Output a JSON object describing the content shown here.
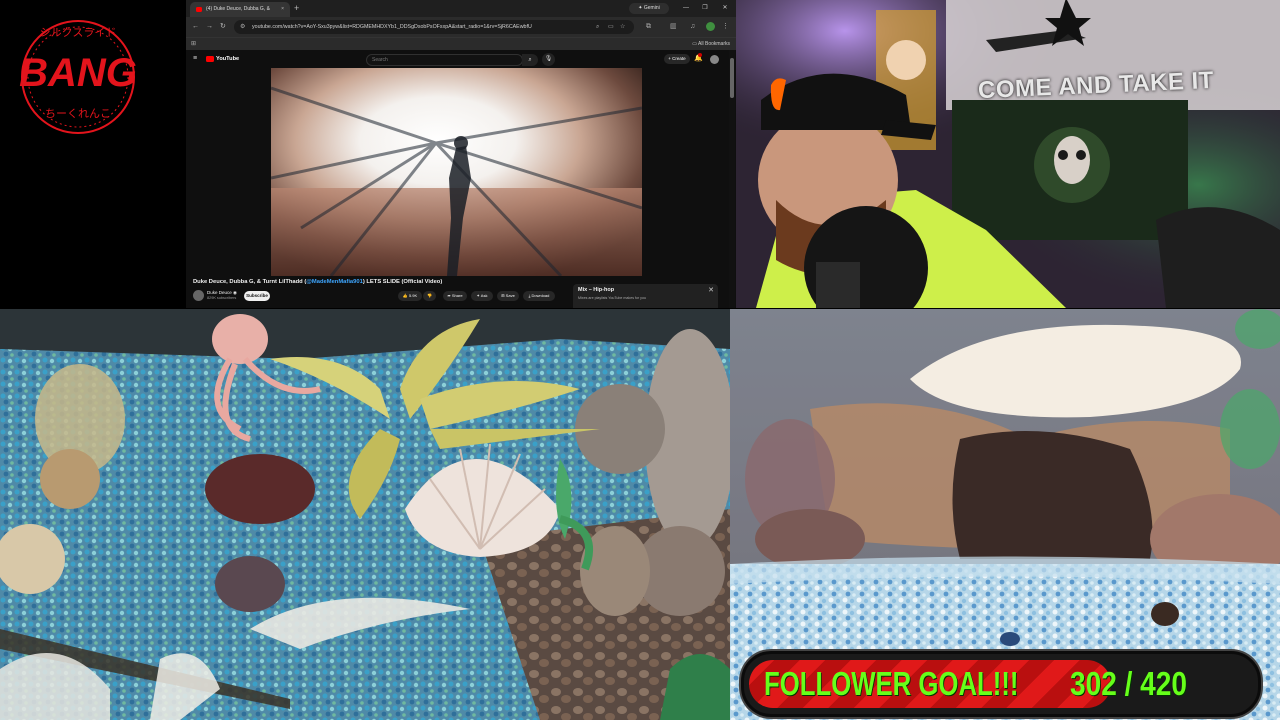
{
  "logo": {
    "text": "BANG",
    "ring_top": "シルクスライド",
    "ring_bottom": "ちーくれんこ",
    "color": "#e3141c"
  },
  "browser": {
    "tab": {
      "title": "(4) Duke Deuce, Dubba G, &",
      "close": "×"
    },
    "new_tab": "+",
    "gemini_label": "Gemini",
    "window_controls": [
      "—",
      "❐",
      "✕"
    ],
    "url": "youtube.com/watch?v=AoY-Sxu3pyw&list=RDGMEMHDXYb1_DDSgDsobPsOFsxpA&start_radio=1&rv=SjR6CAEwbfU",
    "bookmarks_label": "All Bookmarks"
  },
  "youtube": {
    "logo_text": "YouTube",
    "search_placeholder": "Search",
    "create_label": "+ Create",
    "video_title_pre": "Duke Deuce, Dubba G, & Turnt LilThadd (",
    "video_title_mention": "@MadeMenMafia901",
    "video_title_post": ") LETS SLIDE (Official Video)",
    "channel_name": "Duke Deuce ◉",
    "channel_subs": "829K subscribers",
    "subscribe_label": "Subscribe",
    "like_count": "5.9K",
    "share_label": "Share",
    "ask_label": "Ask",
    "save_label": "Save",
    "download_label": "Download",
    "mix_title": "Mix – Hip-hop",
    "mix_subtitle": "Mixes are playlists YouTube makes for you"
  },
  "webcam": {
    "flag_text": "COME AND TAKE IT"
  },
  "goal": {
    "label": "FOLLOWER GOAL!!!",
    "current": 302,
    "target": 420,
    "display": "302 / 420",
    "text_color": "#66ff1a",
    "bar_color": "#e01919"
  }
}
